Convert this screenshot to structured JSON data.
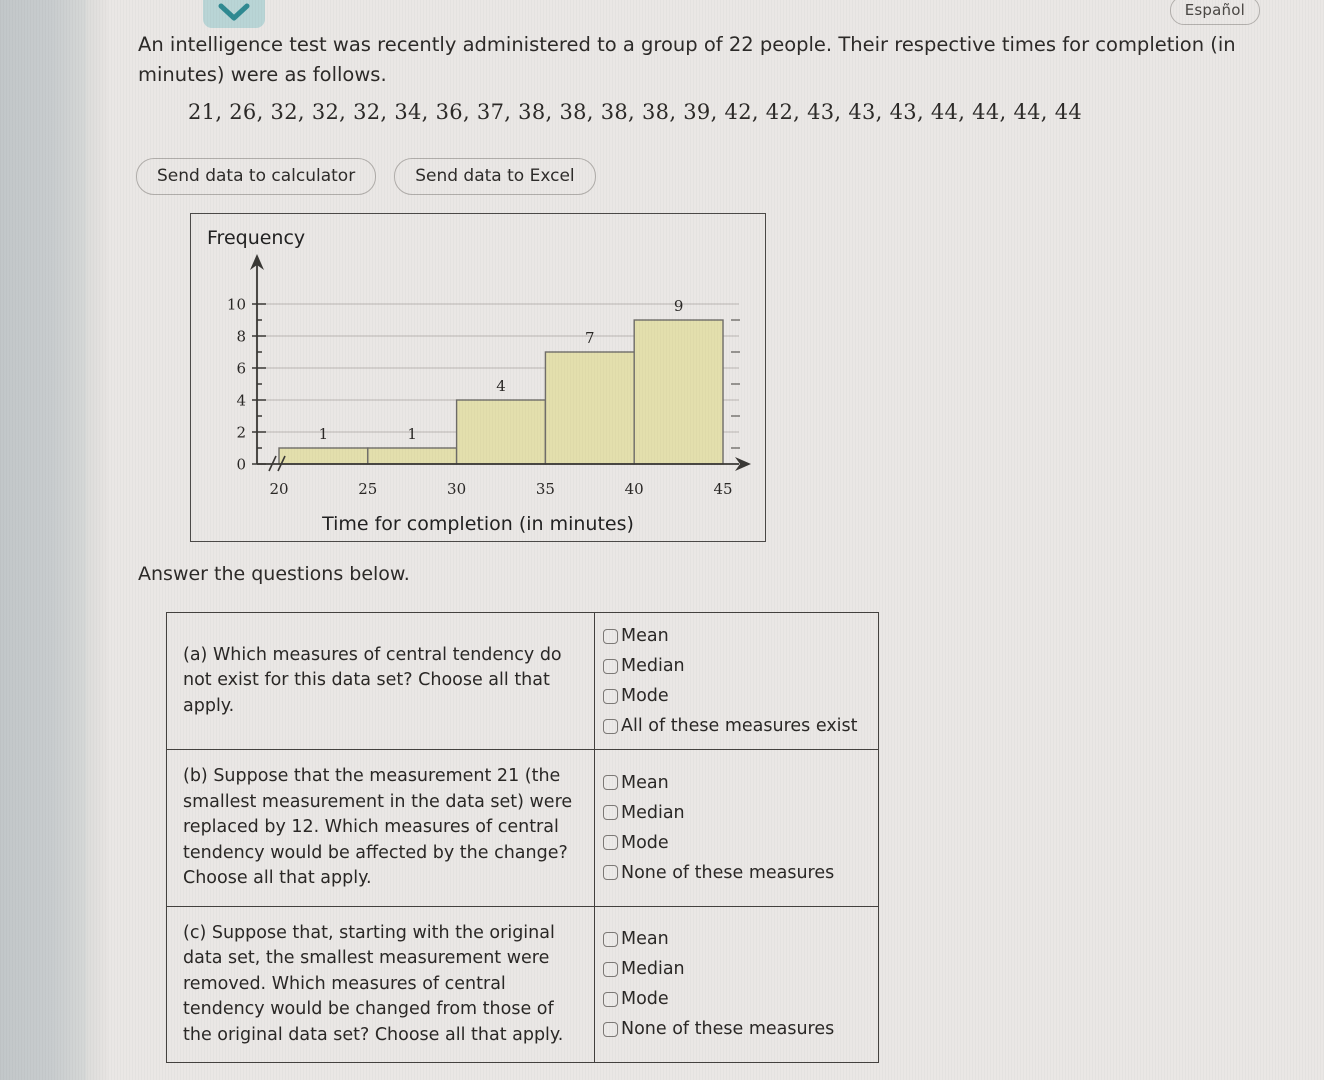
{
  "topbar": {
    "chevron_icon": "chevron-down-icon",
    "espanol_label": "Español"
  },
  "prompt": {
    "text": "An intelligence test was recently administered to a group of 22 people. Their respective times for completion (in minutes) were as follows.",
    "data_values": "21, 26, 32, 32, 32, 34, 36, 37, 38, 38, 38, 38, 39, 42, 42, 43, 43, 43, 44, 44, 44, 44"
  },
  "buttons": {
    "send_calculator": "Send data to calculator",
    "send_excel": "Send data to Excel"
  },
  "chart_data": {
    "type": "bar",
    "title": "",
    "ylabel": "Frequency",
    "xlabel": "Time for completion (in minutes)",
    "categories": [
      "20-25",
      "25-30",
      "30-35",
      "35-40",
      "40-45"
    ],
    "bin_edges": [
      20,
      25,
      30,
      35,
      40,
      45
    ],
    "values": [
      1,
      1,
      4,
      7,
      9
    ],
    "bar_labels": [
      "1",
      "1",
      "4",
      "7",
      "9"
    ],
    "xticks": [
      "20",
      "25",
      "30",
      "35",
      "40",
      "45"
    ],
    "yticks": [
      "0",
      "2",
      "4",
      "6",
      "8",
      "10"
    ],
    "ylim": [
      0,
      11
    ],
    "xlim": [
      20,
      45
    ],
    "grid": true,
    "legend": "none",
    "axis_break": true,
    "bar_fill": "#e3dfad",
    "bar_stroke": "#6f6d69"
  },
  "answers": {
    "lead": "Answer the questions below.",
    "rows": [
      {
        "question": "(a) Which measures of central tendency do not exist for this data set? Choose all that apply.",
        "options": [
          "Mean",
          "Median",
          "Mode",
          "All of these measures exist"
        ]
      },
      {
        "question": "(b) Suppose that the measurement 21 (the smallest measurement in the data set) were replaced by 12. Which measures of central tendency would be affected by the change? Choose all that apply.",
        "options": [
          "Mean",
          "Median",
          "Mode",
          "None of these measures"
        ]
      },
      {
        "question": "(c) Suppose that, starting with the original data set, the smallest measurement were removed. Which measures of central tendency would be changed from those of the original data set? Choose all that apply.",
        "options": [
          "Mean",
          "Median",
          "Mode",
          "None of these measures"
        ]
      }
    ]
  },
  "colors": {
    "page_background": "#eae7e5",
    "text": "#2c2a28",
    "chevron_tile": "#b9d5d6",
    "bar": "#e3dfad",
    "border": "#44423f"
  }
}
